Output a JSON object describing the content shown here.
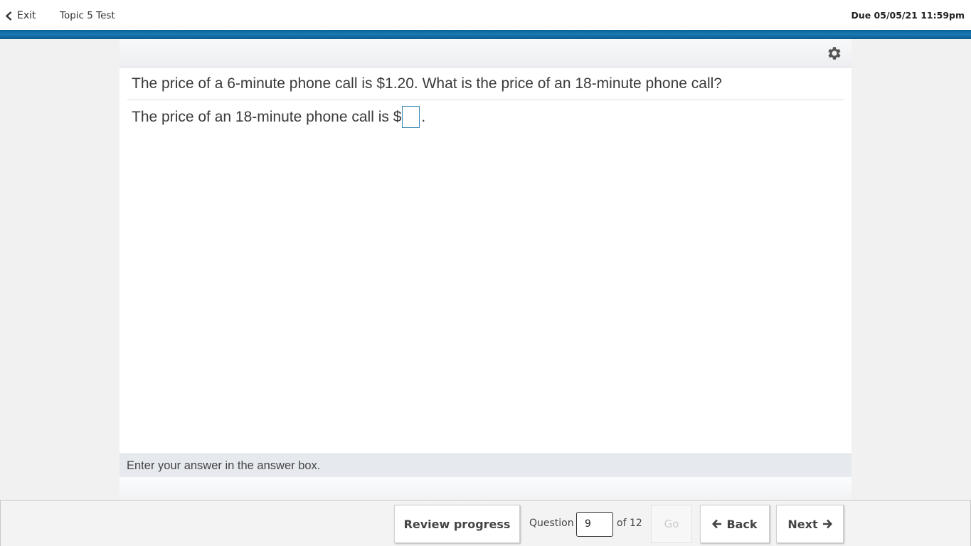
{
  "header": {
    "exit_label": "Exit",
    "test_title": "Topic 5 Test",
    "due_text": "Due 05/05/21 11:59pm"
  },
  "question": {
    "prompt": "The price of a 6-minute phone call is $1.20. What is the price of an 18-minute phone call?",
    "answer_prefix": "The price of an 18-minute phone call is $",
    "answer_suffix": ".",
    "answer_value": "",
    "instruction": "Enter your answer in the answer box."
  },
  "footer": {
    "review_label": "Review progress",
    "question_label": "Question",
    "current_question": "9",
    "of_total": "of 12",
    "go_label": "Go",
    "back_label": "Back",
    "next_label": "Next"
  },
  "colors": {
    "accent_blue": "#1b79b3",
    "answer_box_border": "#3a86b6",
    "instruction_bar": "#e6e9ee"
  },
  "icons": [
    "chevron-left-icon",
    "gear-icon",
    "arrow-left-icon",
    "arrow-right-icon"
  ]
}
